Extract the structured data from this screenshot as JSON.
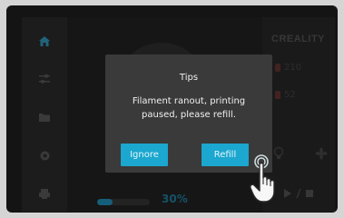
{
  "dialog": {
    "title": "Tips",
    "message": "Filament ranout, printing paused, please refill.",
    "ignore_label": "Ignore",
    "refill_label": "Refill"
  },
  "status": {
    "brand": "CREALITY",
    "nozzle_temp": "210",
    "bed_temp": "52",
    "progress_text": "30%",
    "progress_value": 0.3
  },
  "sidebar": {
    "items": [
      {
        "icon": "home-icon"
      },
      {
        "icon": "adjust-icon"
      },
      {
        "icon": "folder-icon"
      },
      {
        "icon": "settings-icon"
      },
      {
        "icon": "printer-icon"
      }
    ]
  },
  "colors": {
    "accent": "#1ba7cf",
    "dialog_bg": "#3a3a3a",
    "screen_bg": "#1e1e1e"
  }
}
